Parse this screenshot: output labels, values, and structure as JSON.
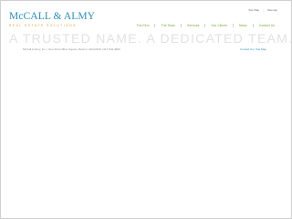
{
  "utility_nav": [
    "Site Map",
    "Sitemap"
  ],
  "logo": {
    "name": "McCALL & ALMY",
    "subtitle": "REAL ESTATE SOLUTIONS"
  },
  "main_nav": [
    "The Firm",
    "The Team",
    "Services",
    "Our Clients",
    "News",
    "Contact Us"
  ],
  "tagline": "A TRUSTED NAME. A DEDICATED TEAM.",
  "footer": {
    "address": "McCall & Almy, Inc. | One Post Office Square, Boston, MA 02109 | 617.542.4800",
    "map_link": "Contact Us | Site Map"
  },
  "colors": {
    "brand_blue": "#2c8fb3",
    "accent_gold": "#d3a32c",
    "nav_green": "#7ba938",
    "tagline_gray": "#e2e2e2"
  }
}
